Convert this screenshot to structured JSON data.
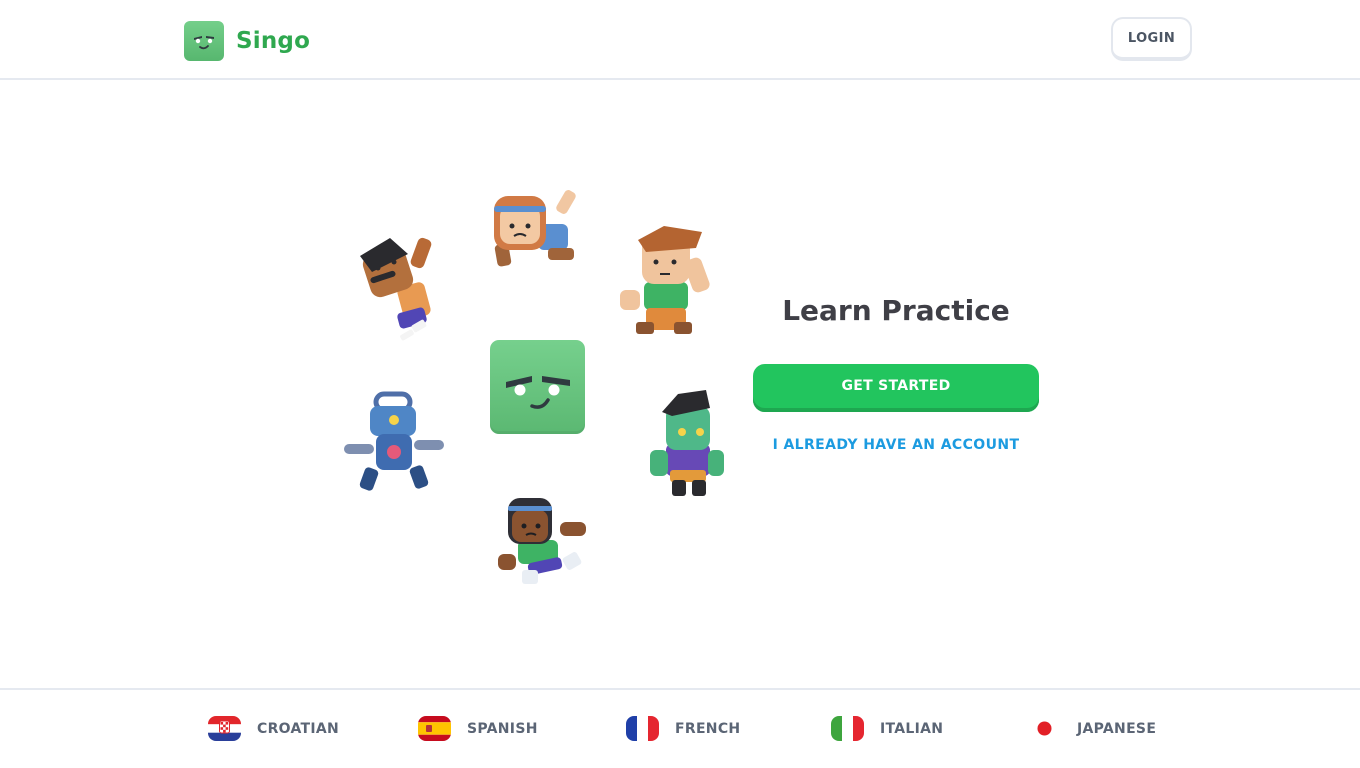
{
  "header": {
    "brand_name": "Singo",
    "login_label": "LOGIN"
  },
  "hero": {
    "title": "Learn Practice",
    "cta_label": "GET STARTED",
    "secondary_label": "I ALREADY HAVE AN ACCOUNT"
  },
  "characters": [
    {
      "name": "mustache-man-icon"
    },
    {
      "name": "headband-girl-icon"
    },
    {
      "name": "green-shirt-boy-icon"
    },
    {
      "name": "blue-robot-icon"
    },
    {
      "name": "zombie-icon"
    },
    {
      "name": "running-girl-icon"
    }
  ],
  "footer": {
    "languages": [
      {
        "label": "CROATIAN",
        "flag": "croatia-flag-icon"
      },
      {
        "label": "SPANISH",
        "flag": "spain-flag-icon"
      },
      {
        "label": "FRENCH",
        "flag": "france-flag-icon"
      },
      {
        "label": "ITALIAN",
        "flag": "italy-flag-icon"
      },
      {
        "label": "JAPANESE",
        "flag": "japan-flag-icon"
      }
    ]
  },
  "colors": {
    "brand_green": "#2fa84f",
    "cta_green": "#22c55e",
    "link_blue": "#1c9be0",
    "text_dark": "#3f3f46"
  }
}
